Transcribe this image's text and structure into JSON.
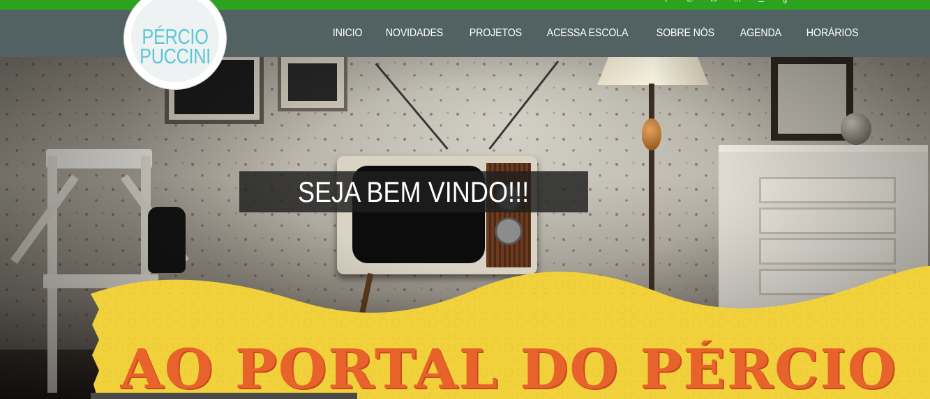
{
  "site": {
    "logo_line1": "PÉRCIO",
    "logo_line2": "PUCCINI"
  },
  "social_icons": [
    "facebook-icon",
    "phone-icon",
    "email-icon",
    "linkedin-icon",
    "rss-icon",
    "google-plus-icon"
  ],
  "social_glyphs": [
    "f",
    "✆",
    "✉",
    "in",
    "☰",
    "g"
  ],
  "nav": {
    "items": [
      {
        "label": "INICIO"
      },
      {
        "label": "NOVIDADES"
      },
      {
        "label": "PROJETOS"
      },
      {
        "label": "ACESSA ESCOLA"
      },
      {
        "label": "SOBRE NÓS"
      },
      {
        "label": "AGENDA"
      },
      {
        "label": "HORÁRIOS"
      }
    ]
  },
  "hero": {
    "welcome": "SEJA BEM VINDO!!!",
    "banner": "AO PORTAL DO PÉRCIO"
  },
  "colors": {
    "topbar": "#2ba31f",
    "navbar": "#526161",
    "logo_text": "#5cc6d6",
    "banner_yellow": "#f2d23c",
    "banner_text": "#e8622b"
  }
}
